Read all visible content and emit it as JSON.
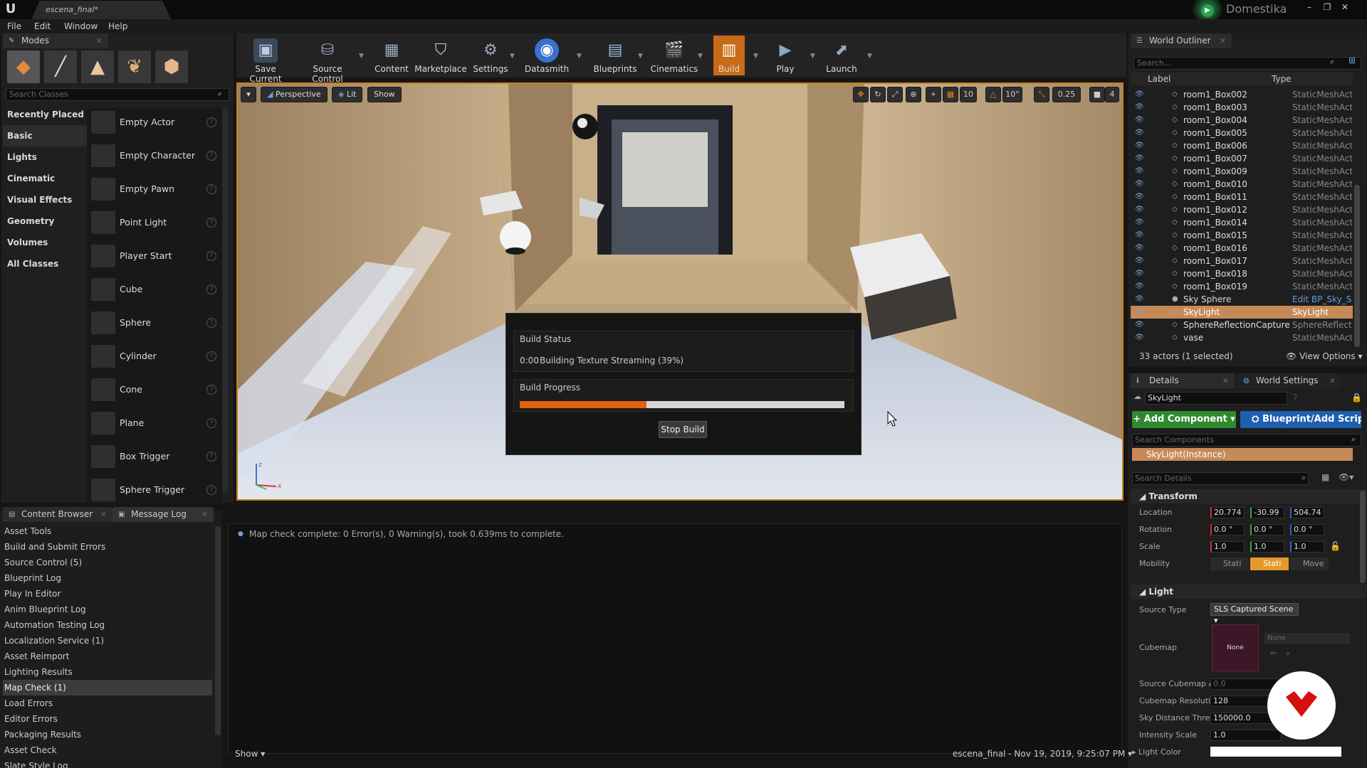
{
  "titlebar": {
    "tab": "escena_final*",
    "brand": "Domestika"
  },
  "menu": [
    "File",
    "Edit",
    "Window",
    "Help"
  ],
  "modes": {
    "tab": "Modes",
    "search_placeholder": "Search Classes",
    "categories": [
      "Recently Placed",
      "Basic",
      "Lights",
      "Cinematic",
      "Visual Effects",
      "Geometry",
      "Volumes",
      "All Classes"
    ],
    "selected_category": "Basic",
    "classes": [
      "Empty Actor",
      "Empty Character",
      "Empty Pawn",
      "Point Light",
      "Player Start",
      "Cube",
      "Sphere",
      "Cylinder",
      "Cone",
      "Plane",
      "Box Trigger",
      "Sphere Trigger"
    ]
  },
  "toolbar": {
    "buttons": [
      "Save Current",
      "Source Control",
      "Content",
      "Marketplace",
      "Settings",
      "Datasmith",
      "Blueprints",
      "Cinematics",
      "Build",
      "Play",
      "Launch"
    ],
    "active": "Build"
  },
  "viewport": {
    "view_mode": "Perspective",
    "lighting": "Lit",
    "show": "Show",
    "grid_snap": "10",
    "rotation_snap": "10°",
    "scale_snap": "0.25",
    "camera_speed": "4"
  },
  "build_dialog": {
    "status_title": "Build Status",
    "time": "0:00",
    "status_text": "Building Texture Streaming (39%)",
    "progress_title": "Build Progress",
    "progress": 0.39,
    "stop_label": "Stop Build"
  },
  "outliner": {
    "tab": "World Outliner",
    "search_placeholder": "Search...",
    "col_label": "Label",
    "col_type": "Type",
    "rows": [
      {
        "label": "room1_Box002",
        "type": "StaticMeshActor"
      },
      {
        "label": "room1_Box003",
        "type": "StaticMeshActor"
      },
      {
        "label": "room1_Box004",
        "type": "StaticMeshActor"
      },
      {
        "label": "room1_Box005",
        "type": "StaticMeshActor"
      },
      {
        "label": "room1_Box006",
        "type": "StaticMeshActor"
      },
      {
        "label": "room1_Box007",
        "type": "StaticMeshActor"
      },
      {
        "label": "room1_Box009",
        "type": "StaticMeshActor"
      },
      {
        "label": "room1_Box010",
        "type": "StaticMeshActor"
      },
      {
        "label": "room1_Box011",
        "type": "StaticMeshActor"
      },
      {
        "label": "room1_Box012",
        "type": "StaticMeshActor"
      },
      {
        "label": "room1_Box014",
        "type": "StaticMeshActor"
      },
      {
        "label": "room1_Box015",
        "type": "StaticMeshActor"
      },
      {
        "label": "room1_Box016",
        "type": "StaticMeshActor"
      },
      {
        "label": "room1_Box017",
        "type": "StaticMeshActor"
      },
      {
        "label": "room1_Box018",
        "type": "StaticMeshActor"
      },
      {
        "label": "room1_Box019",
        "type": "StaticMeshActor"
      },
      {
        "label": "Sky Sphere",
        "type": "Edit BP_Sky_Sphere"
      },
      {
        "label": "SkyLight",
        "type": "SkyLight"
      },
      {
        "label": "SphereReflectionCapture",
        "type": "SphereReflectionCapture"
      },
      {
        "label": "vase",
        "type": "StaticMeshActor"
      }
    ],
    "selected": "SkyLight",
    "summary": "33 actors (1 selected)",
    "view_options": "View Options"
  },
  "details": {
    "tab": "Details",
    "tab2": "World Settings",
    "actor_name": "SkyLight",
    "add_component": "Add Component",
    "blueprint_script": "Blueprint/Add Script",
    "search_components": "Search Components",
    "component": "SkyLight(Instance)",
    "search_details": "Search Details",
    "transform": "Transform",
    "location_label": "Location",
    "location": [
      "20.774",
      "-30.99",
      "504.74"
    ],
    "rotation_label": "Rotation",
    "rotation": [
      "0.0 °",
      "0.0 °",
      "0.0 °"
    ],
    "scale_label": "Scale",
    "scale": [
      "1.0",
      "1.0",
      "1.0"
    ],
    "mobility_label": "Mobility",
    "mobility": [
      "Stati",
      "Stati",
      "Move"
    ],
    "light": "Light",
    "source_type_label": "Source Type",
    "source_type": "SLS Captured Scene",
    "cubemap_label": "Cubemap",
    "cubemap_none": "None",
    "cubemap_select": "None",
    "source_cubemap_angle_label": "Source Cubemap A",
    "source_cubemap_angle": "0.0",
    "cubemap_resolution_label": "Cubemap Resolutio",
    "cubemap_resolution": "128",
    "sky_distance_label": "Sky Distance Thre",
    "sky_distance": "150000.0",
    "intensity_label": "Intensity Scale",
    "intensity": "1.0",
    "light_color_label": "Light Color"
  },
  "bottom": {
    "tab1": "Content Browser",
    "tab2": "Message Log",
    "categories": [
      "Asset Tools",
      "Build and Submit Errors",
      "Source Control (5)",
      "Blueprint Log",
      "Play In Editor",
      "Anim Blueprint Log",
      "Automation Testing Log",
      "Localization Service (1)",
      "Asset Reimport",
      "Lighting Results",
      "Map Check (1)",
      "Load Errors",
      "Editor Errors",
      "Packaging Results",
      "Asset Check",
      "Slate Style Log"
    ],
    "selected": "Map Check (1)",
    "message": "Map check complete: 0 Error(s), 0 Warning(s), took 0.639ms to complete.",
    "show": "Show",
    "footer": "escena_final - Nov 19, 2019, 9:25:07 PM"
  },
  "colors": {
    "accent": "#c96a16",
    "selection": "#c68a58",
    "progress": "#e3620f",
    "add_component": "#2f8a2f",
    "blueprint": "#1f5fb0",
    "stream_logo": "#d60f0f"
  }
}
